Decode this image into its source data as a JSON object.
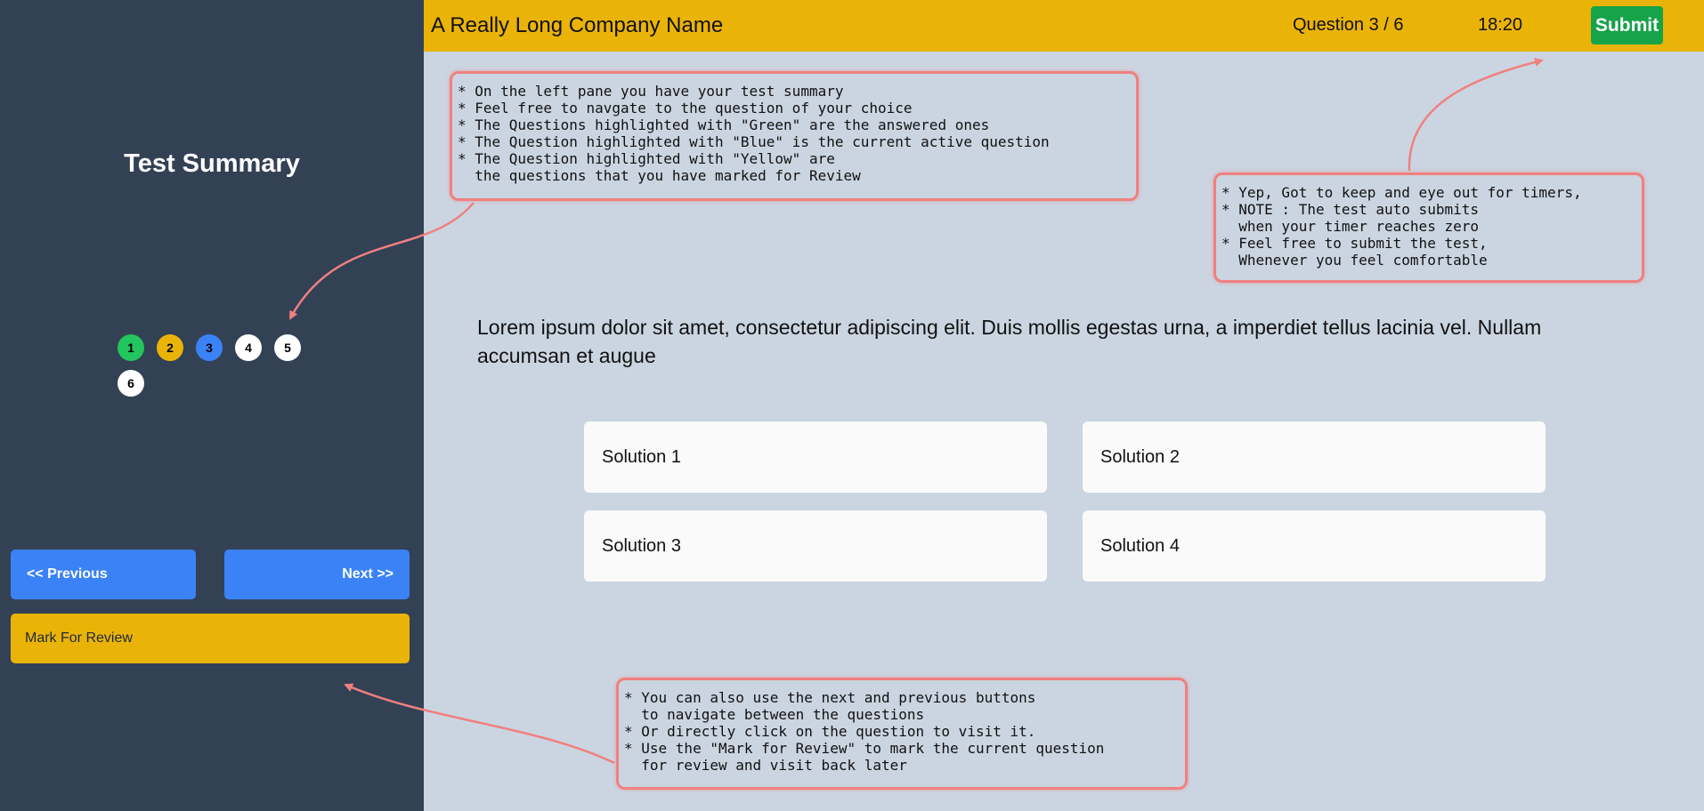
{
  "sidebar": {
    "title": "Test Summary",
    "questions": [
      {
        "label": "1",
        "status": "answered"
      },
      {
        "label": "2",
        "status": "review"
      },
      {
        "label": "3",
        "status": "active"
      },
      {
        "label": "4",
        "status": "unvisited"
      },
      {
        "label": "5",
        "status": "unvisited"
      },
      {
        "label": "6",
        "status": "unvisited"
      }
    ],
    "previous_label": "<< Previous",
    "next_label": "Next >>",
    "review_label": "Mark For Review"
  },
  "header": {
    "company": "A Really Long Company Name",
    "question_counter": "Question 3 / 6",
    "timer": "18:20",
    "submit_label": "Submit"
  },
  "question": {
    "text": "Lorem ipsum dolor sit amet, consectetur adipiscing elit. Duis mollis egestas urna, a imperdiet tellus lacinia vel. Nullam accumsan et augue",
    "solutions": [
      "Solution 1",
      "Solution 2",
      "Solution 3",
      "Solution 4"
    ]
  },
  "notes": {
    "summary": "* On the left pane you have your test summary\n* Feel free to navgate to the question of your choice\n* The Questions highlighted with \"Green\" are the answered ones\n* The Question highlighted with \"Blue\" is the current active question\n* The Question highlighted with \"Yellow\" are\n  the questions that you have marked for Review",
    "timer": "* Yep, Got to keep and eye out for timers,\n* NOTE : The test auto submits\n  when your timer reaches zero\n* Feel free to submit the test,\n  Whenever you feel comfortable",
    "navigation": "* You can also use the next and previous buttons\n  to navigate between the questions\n* Or directly click on the question to visit it.\n* Use the \"Mark for Review\" to mark the current question\n  for review and visit back later"
  },
  "colors": {
    "answered": "#22c55e",
    "review": "#eab308",
    "active": "#3b82f6",
    "unvisited": "#ffffff",
    "header_bg": "#eab308",
    "sidebar_bg": "#334155",
    "submit_bg": "#16a34a",
    "annotation_border": "#f08080"
  }
}
